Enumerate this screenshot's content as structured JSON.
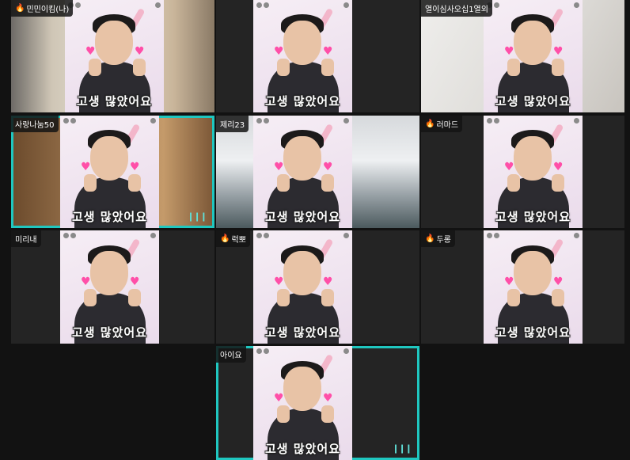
{
  "caption": "고생 많았어요",
  "participants": [
    {
      "name": "민민이킴(나)",
      "badge": "fire"
    },
    {
      "name": ""
    },
    {
      "name": "열이심사오십1열외"
    },
    {
      "name": "사랑나눔50"
    },
    {
      "name": "제리23"
    },
    {
      "name": "러마드",
      "badge": "fire"
    },
    {
      "name": "미리내"
    },
    {
      "name": "럭뽀",
      "badge": "fire"
    },
    {
      "name": "두롱",
      "badge": "fire"
    },
    {
      "name": "아이요"
    }
  ],
  "colors": {
    "active_speaker_green": "#20c84a",
    "active_speaker_cyan": "#1fc7c0"
  }
}
